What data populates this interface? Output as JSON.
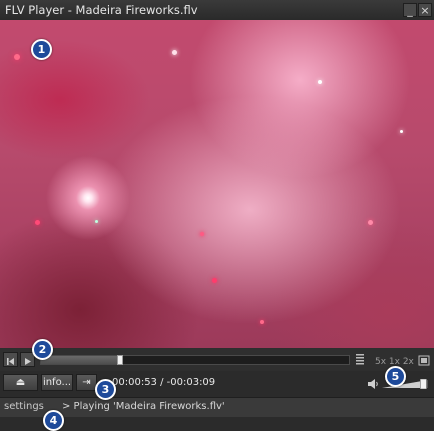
{
  "window": {
    "title": "FLV Player - Madeira Fireworks.flv",
    "minimize_glyph": "_",
    "close_glyph": "×"
  },
  "video": {
    "content": "fireworks video frame"
  },
  "annotations": [
    "1",
    "2",
    "3",
    "4",
    "5"
  ],
  "seek": {
    "progress_fraction": 0.255
  },
  "zoom": {
    "options_label": "5x 1x 2x"
  },
  "controls": {
    "eject_glyph": "⏏",
    "info_label": "info...",
    "step_glyph": "⇥",
    "time_display": "00:00:53 / -00:03:09",
    "volume_level": 0.9
  },
  "status": {
    "settings_label": "settings",
    "message": "> Playing 'Madeira Fireworks.flv'"
  },
  "icons": {
    "prev": "skip-back-icon",
    "play": "play-icon",
    "playlist": "playlist-icon",
    "fullscreen": "fullscreen-icon",
    "eject": "eject-icon",
    "step": "step-forward-icon",
    "volume": "speaker-icon"
  },
  "colors": {
    "badge_fill": "#1e4a9a",
    "badge_border": "#ffffff",
    "window_bg": "#2e2e2e"
  }
}
